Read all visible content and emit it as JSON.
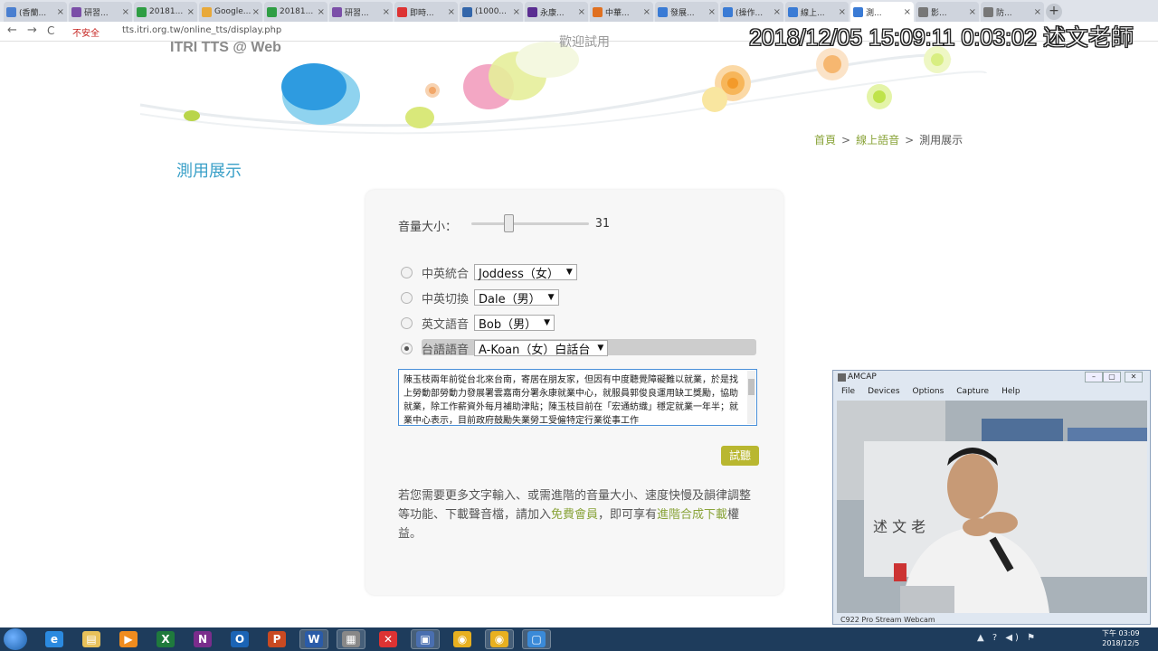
{
  "browser": {
    "tabs": [
      {
        "label": "(香蘭...",
        "color": "#4a7fd0",
        "active": false
      },
      {
        "label": "研習...",
        "color": "#7b4fa8",
        "active": false
      },
      {
        "label": "20181...",
        "color": "#2f9e44",
        "active": false
      },
      {
        "label": "Google...",
        "color": "#e8a93a",
        "active": false
      },
      {
        "label": "20181...",
        "color": "#2f9e44",
        "active": false
      },
      {
        "label": "研習...",
        "color": "#7b4fa8",
        "active": false
      },
      {
        "label": "即時...",
        "color": "#d33",
        "active": false
      },
      {
        "label": "(1000...",
        "color": "#3366aa",
        "active": false
      },
      {
        "label": "永康...",
        "color": "#5a2d91",
        "active": false
      },
      {
        "label": "中華...",
        "color": "#e07020",
        "active": false
      },
      {
        "label": "發展...",
        "color": "#3a7bd5",
        "active": false
      },
      {
        "label": "(操作...",
        "color": "#3a7bd5",
        "active": false
      },
      {
        "label": "線上...",
        "color": "#3a7bd5",
        "active": false
      },
      {
        "label": "測...",
        "color": "#3a7bd5",
        "active": true
      },
      {
        "label": "影...",
        "color": "#777",
        "active": false
      },
      {
        "label": "防...",
        "color": "#777",
        "active": false
      }
    ],
    "tab_close": "×",
    "new_tab": "+",
    "back": "←",
    "forward": "→",
    "reload": "C",
    "insecure_label": "不安全",
    "url": "tts.itri.org.tw/online_tts/display.php",
    "overlay_timestamp": "2018/12/05 15:09:11 0:03:02 述文老師"
  },
  "page": {
    "brand": "ITRI TTS @ Web",
    "banner_text": "歡迎試用",
    "breadcrumb": {
      "home": "首頁",
      "section": "線上語音",
      "current": "測用展示",
      "sep": ">"
    },
    "title": "測用展示",
    "volume": {
      "label": "音量大小：",
      "value": "31",
      "level": 31
    },
    "voices": [
      {
        "label": "中英統合",
        "selected": "Joddess（女）",
        "checked": false
      },
      {
        "label": "中英切換",
        "selected": "Dale（男）",
        "checked": false
      },
      {
        "label": "英文語音",
        "selected": "Bob（男）",
        "checked": false
      },
      {
        "label": "台語語音",
        "selected": "A-Koan（女）白話台",
        "checked": true
      }
    ],
    "textarea_text": "陳玉枝兩年前從台北來台南，寄居在朋友家，但因有中度聽覺障礙難以就業，於是找上勞動部勞動力發展署雲嘉南分署永康就業中心，就服員郭俊良運用缺工獎勵，協助就業，除工作薪資外每月補助津貼；陳玉枝目前在「宏通紡織」穩定就業一年半；就業中心表示，目前政府鼓勵失業勞工受僱特定行業從事工作",
    "try_button": "試聽",
    "desc": {
      "part1": "若您需要更多文字輸入、或需進階的音量大小、速度快慢及韻律調整等功能、下載聲音檔，請加入",
      "link1": "免費會員",
      "part2": "，即可享有",
      "link2": "進階合成下載",
      "part3": "權益。"
    }
  },
  "amcap": {
    "title": "AMCAP",
    "menu": [
      "File",
      "Devices",
      "Options",
      "Capture",
      "Help"
    ],
    "status": "C922 Pro Stream Webcam",
    "board_text": "述 文 老"
  },
  "taskbar": {
    "apps": [
      {
        "name": "ie-icon",
        "glyph": "e",
        "color": "#2b8ae0",
        "on": false
      },
      {
        "name": "explorer-icon",
        "glyph": "▤",
        "color": "#e8c15a",
        "on": false
      },
      {
        "name": "media-player-icon",
        "glyph": "▶",
        "color": "#f08c1e",
        "on": false
      },
      {
        "name": "excel-icon",
        "glyph": "X",
        "color": "#1f7a3d",
        "on": false
      },
      {
        "name": "onenote-icon",
        "glyph": "N",
        "color": "#7a2d8c",
        "on": false
      },
      {
        "name": "outlook-icon",
        "glyph": "O",
        "color": "#1b64b5",
        "on": false
      },
      {
        "name": "powerpoint-icon",
        "glyph": "P",
        "color": "#c94a22",
        "on": false
      },
      {
        "name": "word-icon",
        "glyph": "W",
        "color": "#2a5ba8",
        "on": true
      },
      {
        "name": "app-icon",
        "glyph": "▦",
        "color": "#888",
        "on": true
      },
      {
        "name": "xmind-icon",
        "glyph": "✕",
        "color": "#d33",
        "on": false
      },
      {
        "name": "save-icon",
        "glyph": "▣",
        "color": "#4a6fb0",
        "on": true
      },
      {
        "name": "chrome-icon",
        "glyph": "◉",
        "color": "#e8b020",
        "on": false
      },
      {
        "name": "chrome-alt-icon",
        "glyph": "◉",
        "color": "#e8b020",
        "on": true
      },
      {
        "name": "remote-icon",
        "glyph": "▢",
        "color": "#3a8ad8",
        "on": true
      }
    ],
    "tray": "▲ ? ◀) ⚑",
    "time": "下午 03:09",
    "date": "2018/12/5"
  }
}
